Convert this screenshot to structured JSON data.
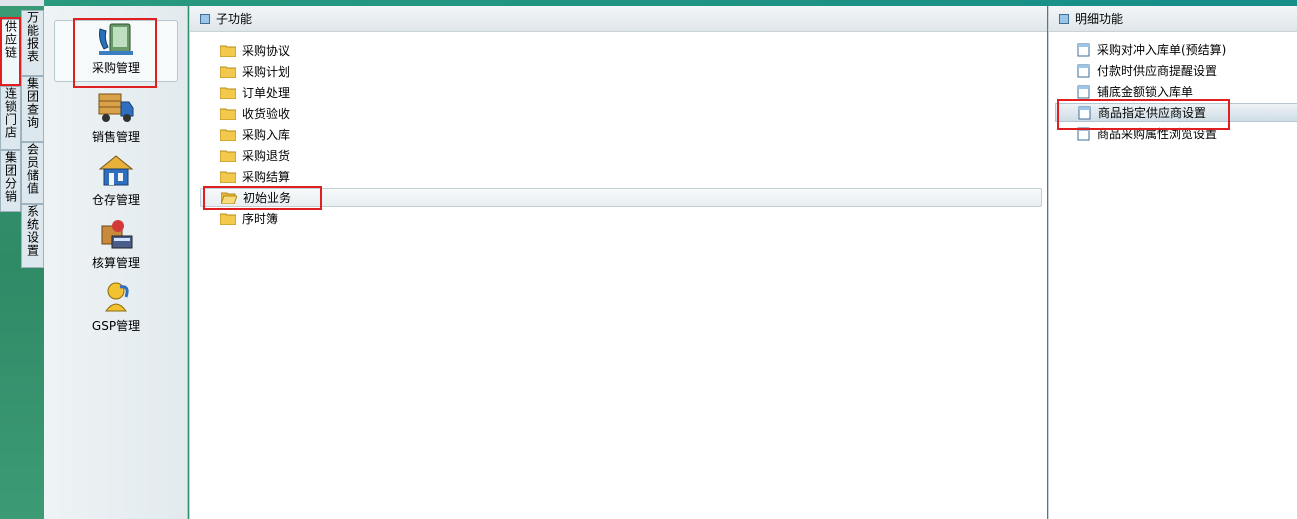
{
  "side_tabs": [
    {
      "label": "供应链"
    },
    {
      "label": "万能报表"
    },
    {
      "label": "连锁门店"
    },
    {
      "label": "集团查询"
    },
    {
      "label": "集团分销"
    },
    {
      "label": "会员储值"
    },
    {
      "label": "系统设置"
    }
  ],
  "nav": {
    "items": [
      {
        "label": "采购管理",
        "icon": "purchase-icon"
      },
      {
        "label": "销售管理",
        "icon": "delivery-truck-icon"
      },
      {
        "label": "仓存管理",
        "icon": "warehouse-icon"
      },
      {
        "label": "核算管理",
        "icon": "accounting-icon"
      },
      {
        "label": "GSP管理",
        "icon": "gsp-person-icon"
      }
    ]
  },
  "sub_panel": {
    "title": "子功能",
    "items": [
      {
        "label": "采购协议"
      },
      {
        "label": "采购计划"
      },
      {
        "label": "订单处理"
      },
      {
        "label": "收货验收"
      },
      {
        "label": "采购入库"
      },
      {
        "label": "采购退货"
      },
      {
        "label": "采购结算"
      },
      {
        "label": "初始业务"
      },
      {
        "label": "序时簿"
      }
    ]
  },
  "detail_panel": {
    "title": "明细功能",
    "items": [
      {
        "label": "采购对冲入库单(预结算)"
      },
      {
        "label": "付款时供应商提醒设置"
      },
      {
        "label": "铺底金额锁入库单"
      },
      {
        "label": "商品指定供应商设置"
      },
      {
        "label": "商品采购属性浏览设置"
      }
    ]
  },
  "colors": {
    "highlight": "#e02020",
    "folder": "#f2c94c",
    "accent": "#3d6f99"
  }
}
